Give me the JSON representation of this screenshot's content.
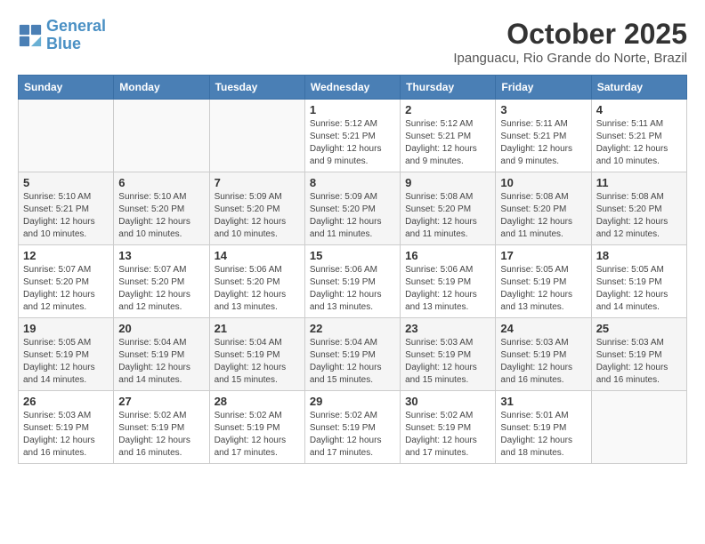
{
  "header": {
    "logo_line1": "General",
    "logo_line2": "Blue",
    "month": "October 2025",
    "location": "Ipanguacu, Rio Grande do Norte, Brazil"
  },
  "days_of_week": [
    "Sunday",
    "Monday",
    "Tuesday",
    "Wednesday",
    "Thursday",
    "Friday",
    "Saturday"
  ],
  "weeks": [
    [
      {
        "day": "",
        "info": ""
      },
      {
        "day": "",
        "info": ""
      },
      {
        "day": "",
        "info": ""
      },
      {
        "day": "1",
        "info": "Sunrise: 5:12 AM\nSunset: 5:21 PM\nDaylight: 12 hours and 9 minutes."
      },
      {
        "day": "2",
        "info": "Sunrise: 5:12 AM\nSunset: 5:21 PM\nDaylight: 12 hours and 9 minutes."
      },
      {
        "day": "3",
        "info": "Sunrise: 5:11 AM\nSunset: 5:21 PM\nDaylight: 12 hours and 9 minutes."
      },
      {
        "day": "4",
        "info": "Sunrise: 5:11 AM\nSunset: 5:21 PM\nDaylight: 12 hours and 10 minutes."
      }
    ],
    [
      {
        "day": "5",
        "info": "Sunrise: 5:10 AM\nSunset: 5:21 PM\nDaylight: 12 hours and 10 minutes."
      },
      {
        "day": "6",
        "info": "Sunrise: 5:10 AM\nSunset: 5:20 PM\nDaylight: 12 hours and 10 minutes."
      },
      {
        "day": "7",
        "info": "Sunrise: 5:09 AM\nSunset: 5:20 PM\nDaylight: 12 hours and 10 minutes."
      },
      {
        "day": "8",
        "info": "Sunrise: 5:09 AM\nSunset: 5:20 PM\nDaylight: 12 hours and 11 minutes."
      },
      {
        "day": "9",
        "info": "Sunrise: 5:08 AM\nSunset: 5:20 PM\nDaylight: 12 hours and 11 minutes."
      },
      {
        "day": "10",
        "info": "Sunrise: 5:08 AM\nSunset: 5:20 PM\nDaylight: 12 hours and 11 minutes."
      },
      {
        "day": "11",
        "info": "Sunrise: 5:08 AM\nSunset: 5:20 PM\nDaylight: 12 hours and 12 minutes."
      }
    ],
    [
      {
        "day": "12",
        "info": "Sunrise: 5:07 AM\nSunset: 5:20 PM\nDaylight: 12 hours and 12 minutes."
      },
      {
        "day": "13",
        "info": "Sunrise: 5:07 AM\nSunset: 5:20 PM\nDaylight: 12 hours and 12 minutes."
      },
      {
        "day": "14",
        "info": "Sunrise: 5:06 AM\nSunset: 5:20 PM\nDaylight: 12 hours and 13 minutes."
      },
      {
        "day": "15",
        "info": "Sunrise: 5:06 AM\nSunset: 5:19 PM\nDaylight: 12 hours and 13 minutes."
      },
      {
        "day": "16",
        "info": "Sunrise: 5:06 AM\nSunset: 5:19 PM\nDaylight: 12 hours and 13 minutes."
      },
      {
        "day": "17",
        "info": "Sunrise: 5:05 AM\nSunset: 5:19 PM\nDaylight: 12 hours and 13 minutes."
      },
      {
        "day": "18",
        "info": "Sunrise: 5:05 AM\nSunset: 5:19 PM\nDaylight: 12 hours and 14 minutes."
      }
    ],
    [
      {
        "day": "19",
        "info": "Sunrise: 5:05 AM\nSunset: 5:19 PM\nDaylight: 12 hours and 14 minutes."
      },
      {
        "day": "20",
        "info": "Sunrise: 5:04 AM\nSunset: 5:19 PM\nDaylight: 12 hours and 14 minutes."
      },
      {
        "day": "21",
        "info": "Sunrise: 5:04 AM\nSunset: 5:19 PM\nDaylight: 12 hours and 15 minutes."
      },
      {
        "day": "22",
        "info": "Sunrise: 5:04 AM\nSunset: 5:19 PM\nDaylight: 12 hours and 15 minutes."
      },
      {
        "day": "23",
        "info": "Sunrise: 5:03 AM\nSunset: 5:19 PM\nDaylight: 12 hours and 15 minutes."
      },
      {
        "day": "24",
        "info": "Sunrise: 5:03 AM\nSunset: 5:19 PM\nDaylight: 12 hours and 16 minutes."
      },
      {
        "day": "25",
        "info": "Sunrise: 5:03 AM\nSunset: 5:19 PM\nDaylight: 12 hours and 16 minutes."
      }
    ],
    [
      {
        "day": "26",
        "info": "Sunrise: 5:03 AM\nSunset: 5:19 PM\nDaylight: 12 hours and 16 minutes."
      },
      {
        "day": "27",
        "info": "Sunrise: 5:02 AM\nSunset: 5:19 PM\nDaylight: 12 hours and 16 minutes."
      },
      {
        "day": "28",
        "info": "Sunrise: 5:02 AM\nSunset: 5:19 PM\nDaylight: 12 hours and 17 minutes."
      },
      {
        "day": "29",
        "info": "Sunrise: 5:02 AM\nSunset: 5:19 PM\nDaylight: 12 hours and 17 minutes."
      },
      {
        "day": "30",
        "info": "Sunrise: 5:02 AM\nSunset: 5:19 PM\nDaylight: 12 hours and 17 minutes."
      },
      {
        "day": "31",
        "info": "Sunrise: 5:01 AM\nSunset: 5:19 PM\nDaylight: 12 hours and 18 minutes."
      },
      {
        "day": "",
        "info": ""
      }
    ]
  ]
}
